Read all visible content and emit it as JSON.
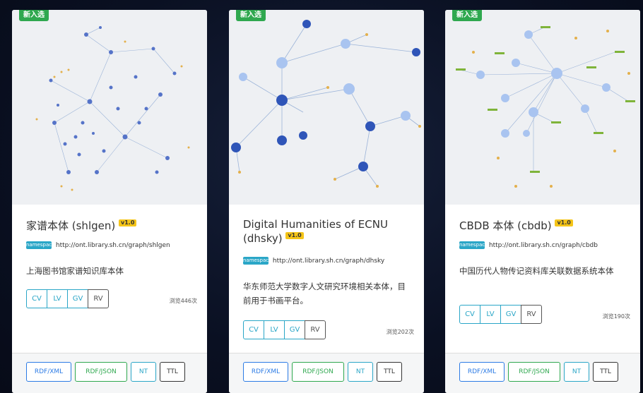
{
  "cards": [
    {
      "tag": "新入选",
      "title": "家谱本体 (shlgen)",
      "version": "v1.0",
      "url_badge": "namespace",
      "url": "http://ont.library.sh.cn/graph/shlgen",
      "description": "上海图书馆家谱知识库本体",
      "view_buttons": [
        "CV",
        "LV",
        "GV",
        "RV"
      ],
      "count": "浏览446次",
      "formats": [
        "RDF/XML",
        "RDF/JSON",
        "NT",
        "TTL"
      ]
    },
    {
      "tag": "新入选",
      "title": "Digital Humanities of ECNU (dhsky)",
      "version": "v1.0",
      "url_badge": "namespace",
      "url": "http://ont.library.sh.cn/graph/dhsky",
      "description": "华东师范大学数字人文研究环境相关本体，目前用于书画平台。",
      "view_buttons": [
        "CV",
        "LV",
        "GV",
        "RV"
      ],
      "count": "浏览202次",
      "formats": [
        "RDF/XML",
        "RDF/JSON",
        "NT",
        "TTL"
      ]
    },
    {
      "tag": "新入选",
      "title": "CBDB 本体 (cbdb)",
      "version": "v1.0",
      "url_badge": "namespace",
      "url": "http://ont.library.sh.cn/graph/cbdb",
      "description": "中国历代人物传记资料库关联数据系统本体",
      "view_buttons": [
        "CV",
        "LV",
        "GV",
        "RV"
      ],
      "count": "浏览190次",
      "formats": [
        "RDF/XML",
        "RDF/JSON",
        "NT",
        "TTL"
      ]
    }
  ]
}
